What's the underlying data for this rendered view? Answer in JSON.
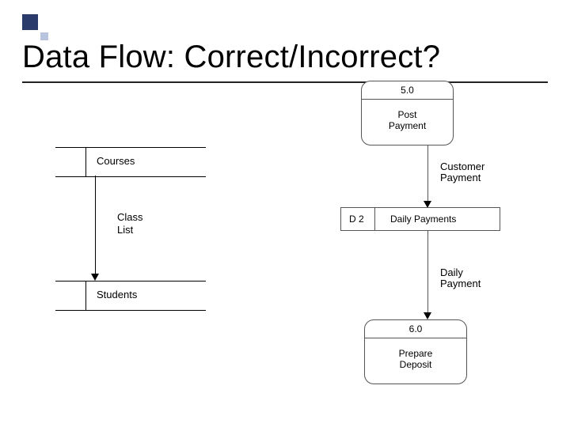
{
  "accent_color": "#2a3a6a",
  "title": "Data Flow: Correct/Incorrect?",
  "left_diagram": {
    "top_store": "Courses",
    "flow_label_line1": "Class",
    "flow_label_line2": "List",
    "bottom_store": "Students"
  },
  "right_diagram": {
    "process_top": {
      "number": "5.0",
      "label_line1": "Post",
      "label_line2": "Payment"
    },
    "flow_top_label_line1": "Customer",
    "flow_top_label_line2": "Payment",
    "datastore": {
      "id": "D 2",
      "label": "Daily Payments"
    },
    "flow_bottom_label_line1": "Daily",
    "flow_bottom_label_line2": "Payment",
    "process_bottom": {
      "number": "6.0",
      "label_line1": "Prepare",
      "label_line2": "Deposit"
    }
  }
}
